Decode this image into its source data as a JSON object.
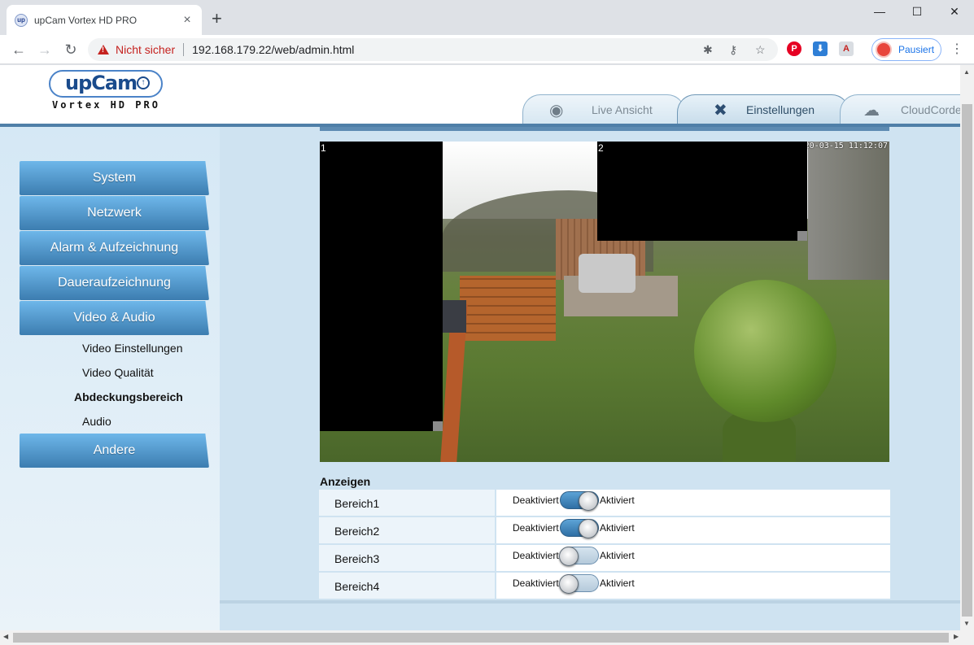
{
  "browser": {
    "tab_title": "upCam Vortex HD PRO",
    "favicon_text": "up",
    "security_label": "Nicht sicher",
    "url": "192.168.179.22/web/admin.html",
    "profile_label": "Pausiert"
  },
  "header": {
    "logo_brand": "upCam",
    "logo_sub": "Vortex HD PRO",
    "tabs": [
      {
        "label": "Live Ansicht",
        "icon": "eye-icon"
      },
      {
        "label": "Einstellungen",
        "icon": "tools-icon"
      },
      {
        "label": "CloudCorder",
        "icon": "cloud-icon"
      }
    ]
  },
  "sidebar": {
    "items": [
      {
        "label": "System"
      },
      {
        "label": "Netzwerk"
      },
      {
        "label": "Alarm & Aufzeichnung"
      },
      {
        "label": "Daueraufzeichnung"
      },
      {
        "label": "Video & Audio"
      },
      {
        "label": "Andere"
      }
    ],
    "subitems": [
      {
        "label": "Video Einstellungen"
      },
      {
        "label": "Video Qualität"
      },
      {
        "label": "Abdeckungsbereich"
      },
      {
        "label": "Audio"
      }
    ]
  },
  "video": {
    "timestamp": "20-03-15 11:12:07",
    "masks": [
      {
        "label": "1"
      },
      {
        "label": "2"
      }
    ]
  },
  "privacy": {
    "section_title": "Anzeigen",
    "off_label": "Deaktiviert",
    "on_label": "Aktiviert",
    "rows": [
      {
        "label": "Bereich1",
        "enabled": true
      },
      {
        "label": "Bereich2",
        "enabled": true
      },
      {
        "label": "Bereich3",
        "enabled": false
      },
      {
        "label": "Bereich4",
        "enabled": false
      }
    ]
  }
}
